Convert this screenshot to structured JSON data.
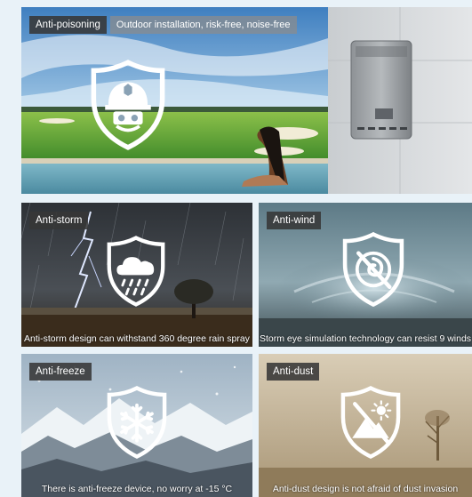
{
  "hero": {
    "tag": "Anti-poisoning",
    "subtitle": "Outdoor installation, risk-free, noise-free",
    "icon": "helmet-shield-icon"
  },
  "tiles": [
    {
      "tag": "Anti-storm",
      "caption": "Anti-storm design can withstand 360 degree rain spray",
      "icon": "rain-cloud-shield-icon"
    },
    {
      "tag": "Anti-wind",
      "caption": "Storm eye simulation technology can resist 9 winds",
      "icon": "whirlwind-shield-icon"
    },
    {
      "tag": "Anti-freeze",
      "caption": "There is anti-freeze device, no worry at -15 °C",
      "icon": "snowflake-shield-icon"
    },
    {
      "tag": "Anti-dust",
      "caption": "Anti-dust design is not afraid of dust invasion",
      "icon": "mountain-sun-shield-icon"
    }
  ]
}
